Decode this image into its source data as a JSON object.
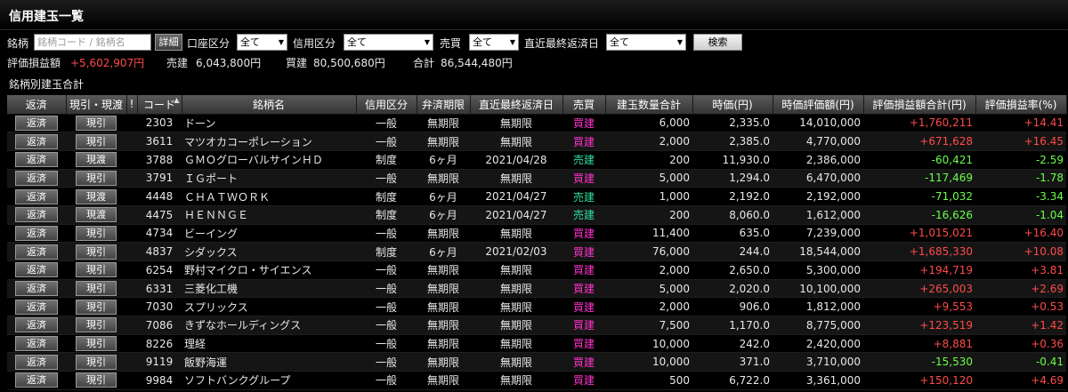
{
  "window": {
    "title": "信用建玉一覧"
  },
  "filters": {
    "brand_label": "銘柄",
    "brand_placeholder": "銘柄コード / 銘柄名",
    "detail_button": "詳細",
    "account_label": "口座区分",
    "account_value": "全て",
    "credit_label": "信用区分",
    "credit_value": "全て",
    "trade_label": "売買",
    "trade_value": "全て",
    "repay_label": "直近最終返済日",
    "repay_value": "全て",
    "search_button": "検索"
  },
  "summary": {
    "pl_label": "評価損益額",
    "pl_value": "+5,602,907円",
    "sell_label": "売建",
    "sell_value": "6,043,800円",
    "buy_label": "買建",
    "buy_value": "80,500,680円",
    "total_label": "合計",
    "total_value": "86,544,480円"
  },
  "section_title": "銘柄別建玉合計",
  "columns": [
    "返済",
    "現引・現渡",
    "!",
    "コード",
    "銘柄名",
    "信用区分",
    "弁済期限",
    "直近最終返済日",
    "売買",
    "建玉数量合計",
    "時価(円)",
    "時価評価額(円)",
    "評価損益額合計(円)",
    "評価損益率(%)"
  ],
  "rows": [
    {
      "repay": "返済",
      "action": "現引",
      "code": "2303",
      "name": "ドーン",
      "credit": "一般",
      "term": "無期限",
      "last_date": "無期限",
      "side": "買建",
      "qty": "6,000",
      "price": "2,335.0",
      "value": "14,010,000",
      "pl": "+1,760,211",
      "rate": "+14.41"
    },
    {
      "repay": "返済",
      "action": "現引",
      "code": "3611",
      "name": "マツオカコーポレーション",
      "credit": "一般",
      "term": "無期限",
      "last_date": "無期限",
      "side": "買建",
      "qty": "2,000",
      "price": "2,385.0",
      "value": "4,770,000",
      "pl": "+671,628",
      "rate": "+16.45"
    },
    {
      "repay": "返済",
      "action": "現渡",
      "code": "3788",
      "name": "ＧＭＯグローバルサインＨＤ",
      "credit": "制度",
      "term": "6ヶ月",
      "last_date": "2021/04/28",
      "side": "売建",
      "qty": "200",
      "price": "11,930.0",
      "value": "2,386,000",
      "pl": "-60,421",
      "rate": "-2.59"
    },
    {
      "repay": "返済",
      "action": "現引",
      "code": "3791",
      "name": "ＩＧポート",
      "credit": "一般",
      "term": "無期限",
      "last_date": "無期限",
      "side": "買建",
      "qty": "5,000",
      "price": "1,294.0",
      "value": "6,470,000",
      "pl": "-117,469",
      "rate": "-1.78"
    },
    {
      "repay": "返済",
      "action": "現渡",
      "code": "4448",
      "name": "ＣＨＡＴＷＯＲＫ",
      "credit": "制度",
      "term": "6ヶ月",
      "last_date": "2021/04/27",
      "side": "売建",
      "qty": "1,000",
      "price": "2,192.0",
      "value": "2,192,000",
      "pl": "-71,032",
      "rate": "-3.34"
    },
    {
      "repay": "返済",
      "action": "現渡",
      "code": "4475",
      "name": "ＨＥＮＮＧＥ",
      "credit": "制度",
      "term": "6ヶ月",
      "last_date": "2021/04/27",
      "side": "売建",
      "qty": "200",
      "price": "8,060.0",
      "value": "1,612,000",
      "pl": "-16,626",
      "rate": "-1.04"
    },
    {
      "repay": "返済",
      "action": "現引",
      "code": "4734",
      "name": "ビーイング",
      "credit": "一般",
      "term": "無期限",
      "last_date": "無期限",
      "side": "買建",
      "qty": "11,400",
      "price": "635.0",
      "value": "7,239,000",
      "pl": "+1,015,021",
      "rate": "+16.40"
    },
    {
      "repay": "返済",
      "action": "現引",
      "code": "4837",
      "name": "シダックス",
      "credit": "制度",
      "term": "6ヶ月",
      "last_date": "2021/02/03",
      "side": "買建",
      "qty": "76,000",
      "price": "244.0",
      "value": "18,544,000",
      "pl": "+1,685,330",
      "rate": "+10.08"
    },
    {
      "repay": "返済",
      "action": "現引",
      "code": "6254",
      "name": "野村マイクロ・サイエンス",
      "credit": "一般",
      "term": "無期限",
      "last_date": "無期限",
      "side": "買建",
      "qty": "2,000",
      "price": "2,650.0",
      "value": "5,300,000",
      "pl": "+194,719",
      "rate": "+3.81"
    },
    {
      "repay": "返済",
      "action": "現引",
      "code": "6331",
      "name": "三菱化工機",
      "credit": "一般",
      "term": "無期限",
      "last_date": "無期限",
      "side": "買建",
      "qty": "5,000",
      "price": "2,020.0",
      "value": "10,100,000",
      "pl": "+265,003",
      "rate": "+2.69"
    },
    {
      "repay": "返済",
      "action": "現引",
      "code": "7030",
      "name": "スプリックス",
      "credit": "一般",
      "term": "無期限",
      "last_date": "無期限",
      "side": "買建",
      "qty": "2,000",
      "price": "906.0",
      "value": "1,812,000",
      "pl": "+9,553",
      "rate": "+0.53"
    },
    {
      "repay": "返済",
      "action": "現引",
      "code": "7086",
      "name": "きずなホールディングス",
      "credit": "一般",
      "term": "無期限",
      "last_date": "無期限",
      "side": "買建",
      "qty": "7,500",
      "price": "1,170.0",
      "value": "8,775,000",
      "pl": "+123,519",
      "rate": "+1.42"
    },
    {
      "repay": "返済",
      "action": "現引",
      "code": "8226",
      "name": "理経",
      "credit": "一般",
      "term": "無期限",
      "last_date": "無期限",
      "side": "買建",
      "qty": "10,000",
      "price": "242.0",
      "value": "2,420,000",
      "pl": "+8,881",
      "rate": "+0.36"
    },
    {
      "repay": "返済",
      "action": "現引",
      "code": "9119",
      "name": "飯野海運",
      "credit": "一般",
      "term": "無期限",
      "last_date": "無期限",
      "side": "買建",
      "qty": "10,000",
      "price": "371.0",
      "value": "3,710,000",
      "pl": "-15,530",
      "rate": "-0.41"
    },
    {
      "repay": "返済",
      "action": "現引",
      "code": "9984",
      "name": "ソフトバンクグループ",
      "credit": "一般",
      "term": "無期限",
      "last_date": "無期限",
      "side": "買建",
      "qty": "500",
      "price": "6,722.0",
      "value": "3,361,000",
      "pl": "+150,120",
      "rate": "+4.69"
    }
  ],
  "colors": {
    "buy": "#ff33cc",
    "sell": "#2fe0a0",
    "gain": "#ff4a4a",
    "loss": "#6aff4a"
  },
  "icons": {
    "sort": "sort-up-icon",
    "dropdown": "chevron-down-icon"
  }
}
